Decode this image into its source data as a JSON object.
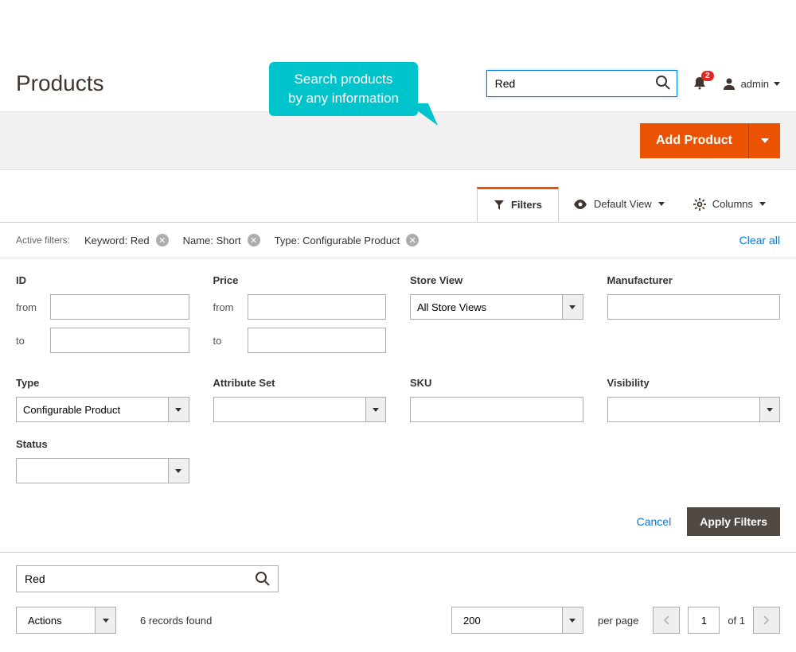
{
  "callout": {
    "line1": "Search products",
    "line2": "by any information"
  },
  "header": {
    "title": "Products",
    "search_value": "Red",
    "notif_count": "2",
    "user_name": "admin"
  },
  "toolbar": {
    "add_product_label": "Add Product"
  },
  "view_controls": {
    "filters_label": "Filters",
    "default_view_label": "Default View",
    "columns_label": "Columns"
  },
  "active_filters": {
    "label": "Active filters:",
    "chips": [
      {
        "text": "Keyword: Red"
      },
      {
        "text": "Name: Short"
      },
      {
        "text": "Type: Configurable Product"
      }
    ],
    "clear_all": "Clear all"
  },
  "filters": {
    "id": {
      "label": "ID",
      "from": "from",
      "to": "to",
      "from_val": "",
      "to_val": ""
    },
    "price": {
      "label": "Price",
      "from": "from",
      "to": "to",
      "from_val": "",
      "to_val": ""
    },
    "store_view": {
      "label": "Store View",
      "value": "All Store Views"
    },
    "manufacturer": {
      "label": "Manufacturer",
      "value": ""
    },
    "type": {
      "label": "Type",
      "value": "Configurable Product"
    },
    "attribute_set": {
      "label": "Attribute Set",
      "value": ""
    },
    "sku": {
      "label": "SKU",
      "value": ""
    },
    "visibility": {
      "label": "Visibility",
      "value": ""
    },
    "status": {
      "label": "Status",
      "value": ""
    }
  },
  "form_actions": {
    "cancel": "Cancel",
    "apply": "Apply Filters"
  },
  "grid": {
    "keyword_value": "Red",
    "actions_label": "Actions",
    "records_found": "6 records found",
    "page_size": "200",
    "per_page_label": "per page",
    "current_page": "1",
    "of_pages": "of 1"
  }
}
